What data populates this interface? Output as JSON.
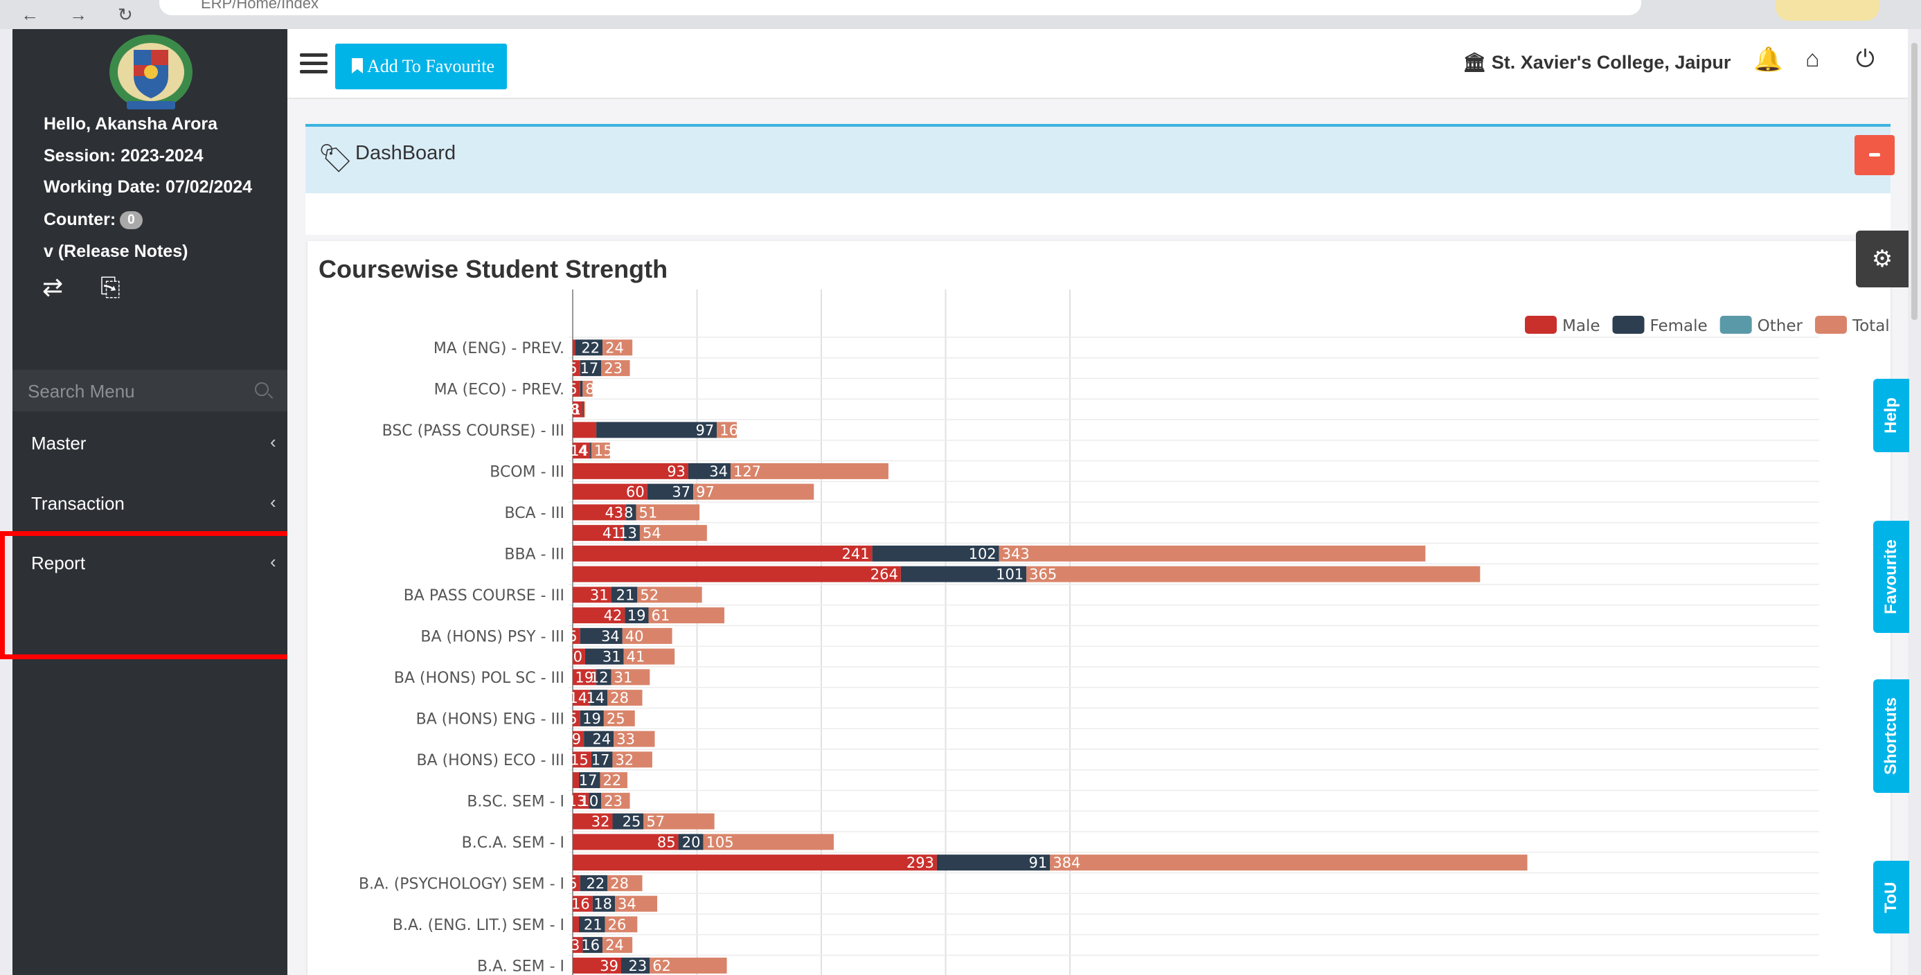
{
  "browser": {
    "url": "ERP/Home/Index"
  },
  "sidebar": {
    "greeting": "Hello, Akansha Arora",
    "session": "Session: 2023-2024",
    "working_date": "Working Date: 07/02/2024",
    "counter_label": "Counter:",
    "counter_value": "0",
    "release_notes": "v (Release Notes)",
    "search_placeholder": "Search Menu",
    "menu": [
      {
        "label": "Master"
      },
      {
        "label": "Transaction"
      },
      {
        "label": "Report"
      }
    ]
  },
  "topbar": {
    "add_favourite": "Add To Favourite",
    "college": "St. Xavier's College, Jaipur"
  },
  "content": {
    "breadcrumb": "DashBoard"
  },
  "side_tabs": {
    "help": "Help",
    "favourite": "Favourite",
    "shortcuts": "Shortcuts",
    "tou": "ToU"
  },
  "colors": {
    "male": "#c9302c",
    "female": "#2c3e50",
    "other": "#5a9aa8",
    "total": "#d9846a"
  },
  "chart_data": {
    "type": "bar",
    "orientation": "horizontal",
    "stacked": true,
    "title": "Coursewise Student Strength",
    "legend": [
      "Male",
      "Female",
      "Other",
      "Total"
    ],
    "legend_position": "top-right",
    "grid": true,
    "tick_labels": [
      "MA (ENG) - PREV.",
      "MA (ECO) - PREV.",
      "BSC (PASS COURSE) - III",
      "BCOM - III",
      "BCA  - III",
      "BBA - III",
      "BA PASS COURSE - III",
      "BA (HONS) PSY - III",
      "BA (HONS) POL SC - III",
      "BA (HONS) ENG - III",
      "BA (HONS) ECO - III",
      "B.SC. SEM - I",
      "B.C.A. SEM - I",
      "B.A. (PSYCHOLOGY) SEM - I",
      "B.A. (ENG. LIT.) SEM - I",
      "B.A. SEM - I"
    ],
    "categories": [
      "MA (ENG) - PREV. a",
      "MA (ENG) - PREV. b",
      "MA (ECO) - PREV. a",
      "MA (ECO) - PREV. b",
      "BSC (PASS COURSE) - III a",
      "BSC (PASS COURSE) - III b",
      "BCOM - III a",
      "BCOM - III b",
      "BCA  - III a",
      "BCA  - III b",
      "BBA - III a",
      "BBA - III b",
      "BA PASS COURSE - III a",
      "BA PASS COURSE - III b",
      "BA (HONS) PSY - III a",
      "BA (HONS) PSY - III b",
      "BA (HONS) POL SC - III a",
      "BA (HONS) POL SC - III b",
      "BA (HONS) ENG - III a",
      "BA (HONS) ENG - III b",
      "BA (HONS) ECO - III a",
      "BA (HONS) ECO - III b",
      "B.SC. SEM - I a",
      "B.SC. SEM - I b",
      "B.C.A. SEM - I a",
      "B.C.A. SEM - I b",
      "B.A. (PSYCHOLOGY) SEM - I a",
      "B.A. (PSYCHOLOGY) SEM - I b",
      "B.A. (ENG. LIT.) SEM - I a",
      "B.A. (ENG. LIT.) SEM - I b",
      "B.A. SEM - I a",
      "B.A. SEM - I b"
    ],
    "series": [
      {
        "name": "Male",
        "values": [
          2,
          6,
          6,
          8,
          19,
          14,
          93,
          60,
          43,
          41,
          241,
          264,
          31,
          42,
          6,
          10,
          19,
          14,
          6,
          9,
          15,
          5,
          13,
          32,
          85,
          293,
          6,
          16,
          5,
          8,
          39,
          0
        ]
      },
      {
        "name": "Female",
        "values": [
          22,
          17,
          2,
          1,
          97,
          1,
          34,
          37,
          8,
          13,
          102,
          101,
          21,
          19,
          34,
          31,
          12,
          14,
          19,
          24,
          17,
          17,
          10,
          25,
          20,
          91,
          22,
          18,
          21,
          16,
          23,
          0
        ]
      },
      {
        "name": "Other",
        "values": [
          0,
          0,
          0,
          0,
          0,
          0,
          0,
          0,
          0,
          0,
          0,
          0,
          0,
          0,
          0,
          0,
          0,
          0,
          0,
          0,
          0,
          0,
          0,
          0,
          0,
          0,
          0,
          0,
          0,
          0,
          0,
          0
        ]
      },
      {
        "name": "Total",
        "values": [
          24,
          23,
          8,
          1,
          16,
          15,
          127,
          97,
          51,
          54,
          343,
          365,
          52,
          61,
          40,
          41,
          31,
          28,
          25,
          33,
          32,
          22,
          23,
          57,
          105,
          384,
          28,
          34,
          26,
          24,
          62,
          0
        ]
      }
    ],
    "labels": {
      "Male": [
        "",
        "5",
        "5",
        "8",
        "",
        "4",
        "93",
        "60",
        "43",
        "41",
        "241",
        "264",
        "31",
        "42",
        "5",
        "0",
        "19",
        "14",
        "5",
        "9",
        "15",
        "",
        "13",
        "32",
        "85",
        "293",
        "5",
        "16",
        "",
        "3",
        "39",
        ""
      ],
      "Female": [
        "22",
        "17",
        "",
        "1",
        "97",
        "14",
        "34",
        "37",
        "8",
        "13",
        "102",
        "101",
        "21",
        "19",
        "34",
        "31",
        "12",
        "14",
        "19",
        "24",
        "17",
        "17",
        "10",
        "25",
        "20",
        "91",
        "22",
        "18",
        "21",
        "16",
        "23",
        ""
      ],
      "Total": [
        "24",
        "23",
        "8",
        "",
        "16",
        "15",
        "127",
        "97",
        "51",
        "54",
        "343",
        "365",
        "52",
        "61",
        "40",
        "41",
        "31",
        "28",
        "25",
        "33",
        "32",
        "22",
        "23",
        "57",
        "105",
        "384",
        "28",
        "34",
        "26",
        "24",
        "62",
        ""
      ]
    },
    "xlim": [
      0,
      400
    ]
  }
}
